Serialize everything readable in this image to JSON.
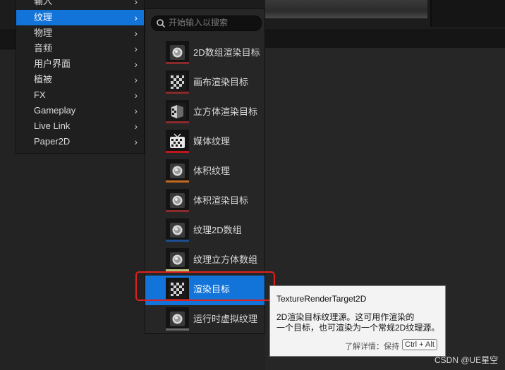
{
  "main_menu": {
    "items": [
      {
        "label": "输入"
      },
      {
        "label": "纹理",
        "active": true
      },
      {
        "label": "物理"
      },
      {
        "label": "音频"
      },
      {
        "label": "用户界面"
      },
      {
        "label": "植被"
      },
      {
        "label": "FX"
      },
      {
        "label": "Gameplay"
      },
      {
        "label": "Live Link"
      },
      {
        "label": "Paper2D"
      }
    ],
    "chevron": "›"
  },
  "submenu": {
    "search_placeholder": "开始输入以搜索",
    "search_icon": "search-icon",
    "items": [
      {
        "label": "2D数组渲染目标",
        "icon": "sphere-thumbnail",
        "bar_color": "#8b2a2a"
      },
      {
        "label": "画布渲染目标",
        "icon": "checker-thumbnail",
        "bar_color": "#8b2a2a"
      },
      {
        "label": "立方体渲染目标",
        "icon": "cube-checker-thumbnail",
        "bar_color": "#8b2a2a"
      },
      {
        "label": "媒体纹理",
        "icon": "tv-thumbnail",
        "bar_color": "#c0151a"
      },
      {
        "label": "体积纹理",
        "icon": "sphere-thumbnail",
        "bar_color": "#c46a1e"
      },
      {
        "label": "体积渲染目标",
        "icon": "sphere-thumbnail",
        "bar_color": "#8b2a2a"
      },
      {
        "label": "纹理2D数组",
        "icon": "sphere-thumbnail",
        "bar_color": "#1c4f8f"
      },
      {
        "label": "纹理立方体数组",
        "icon": "sphere-thumbnail",
        "bar_color": "#b8c27a"
      },
      {
        "label": "渲染目标",
        "icon": "checker-thumbnail",
        "bar_color": "#8b2a2a",
        "active": true
      },
      {
        "label": "运行时虚拟纹理",
        "icon": "sphere-thumbnail",
        "bar_color": "#6a6a6a"
      }
    ]
  },
  "tooltip": {
    "title": "TextureRenderTarget2D",
    "desc_line1": "2D渲染目标纹理源。这可用作渲染的",
    "desc_line2": "一个目标，也可渲染为一个常规2D纹理源。",
    "more": "了解详情：保持",
    "shortcut": "Ctrl + Alt"
  },
  "watermark": "CSDN @UE星空",
  "colors": {
    "accent": "#1273d8",
    "highlight_box": "#e0201c"
  }
}
